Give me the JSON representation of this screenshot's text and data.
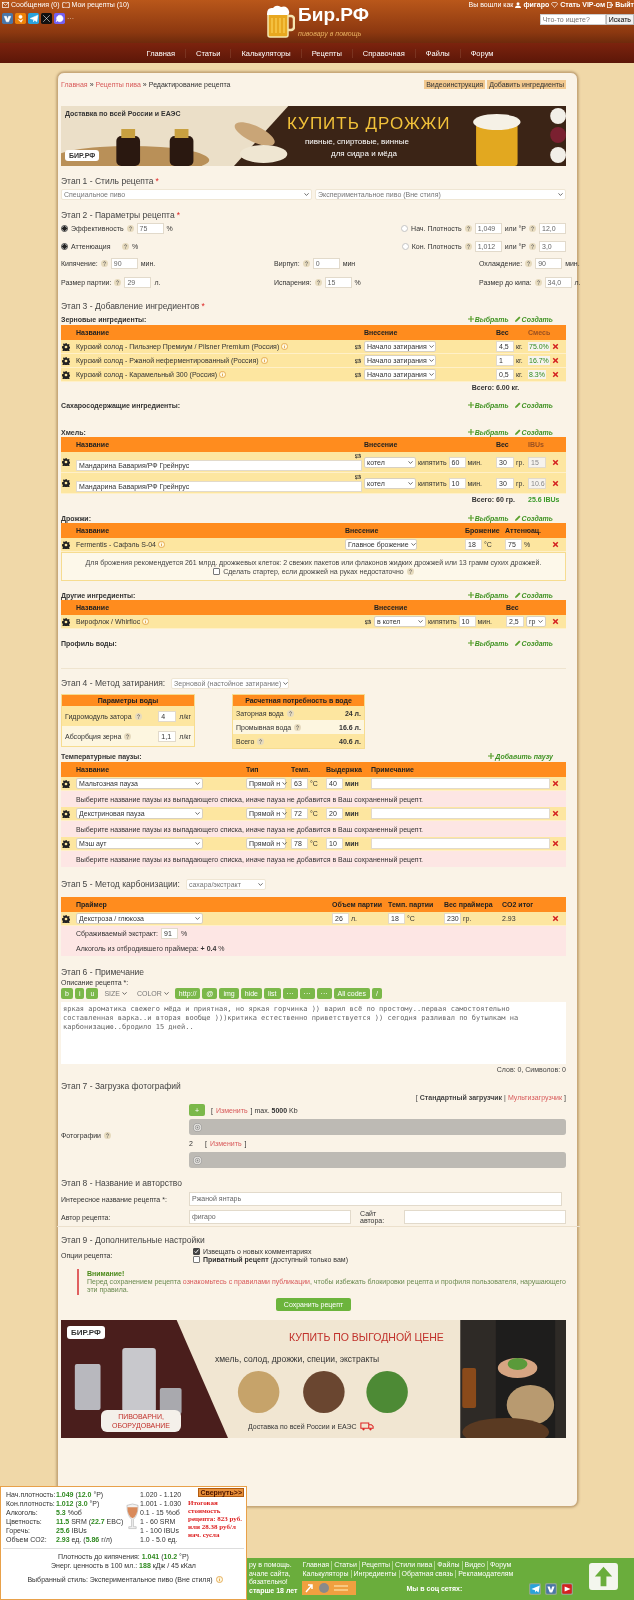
{
  "header": {
    "messages": "Сообщения (0)",
    "recipes": "Мои рецепты (10)",
    "login_prefix": "Вы вошли как",
    "user": "фигаро",
    "vip": "Стать VIP-ом",
    "logout": "Выйт",
    "share_more": "···",
    "logo": "Бир.РФ",
    "tagline": "пивовару в помощь",
    "search_placeholder": "Что-то ищете?",
    "search_button": "Искать"
  },
  "nav": [
    "Главная",
    "Статьи",
    "Калькуляторы",
    "Рецепты",
    "Справочная",
    "Файлы",
    "Форум"
  ],
  "breadcrumbs": {
    "items": [
      {
        "text": "Главная",
        "sep": "»"
      },
      {
        "text": "Рецепты пива",
        "sep": "»"
      }
    ],
    "current": "Редактирование рецепта"
  },
  "actions": [
    "Видеоинструкция",
    "Добавить ингредиенты"
  ],
  "banner_top": {
    "delivery": "Доставка по всей России и ЕАЭС",
    "brand": "БИР.РФ",
    "headline": "КУПИТЬ ДРОЖЖИ",
    "line1": "пивные, спиртовые, винные",
    "line2": "для сидра и мёда"
  },
  "stage1": {
    "title": "Этап 1 - Стиль рецепта",
    "required": "*",
    "selects": [
      "Специальное пиво",
      "Экспериментальное пиво (Вне стиля)"
    ]
  },
  "stage2": {
    "title": "Этап 2 - Параметры рецепта",
    "required": "*",
    "radio_rows": [
      {
        "left": {
          "label": "Эффективность",
          "selected": true,
          "value": "75",
          "unit": "%"
        },
        "right": {
          "label": "Нач. Плотность",
          "selected": false,
          "value": "1,049",
          "alt_label": "или °P",
          "alt_value": "12,0"
        }
      },
      {
        "left": {
          "label": "Аттенюация",
          "selected": true,
          "unit": "%"
        },
        "right": {
          "label": "Кон. Плотность",
          "selected": false,
          "value": "1,012",
          "alt_label": "или °P",
          "alt_value": "3,0"
        }
      }
    ],
    "rows": [
      [
        {
          "label": "Кипячение:",
          "value": "90",
          "unit": "мин."
        },
        {
          "label": "Вирпул:",
          "value": "0",
          "unit": "мин"
        },
        {
          "label": "Охлаждение:",
          "value": "90",
          "unit": "мин."
        }
      ],
      [
        {
          "label": "Размер партии:",
          "value": "29",
          "unit": "л."
        },
        {
          "label": "Испарения:",
          "value": "15",
          "unit": "%"
        },
        {
          "label": "Размер до кипа:",
          "value": "34,0",
          "unit": "л."
        }
      ]
    ]
  },
  "stage3": {
    "title": "Этап 3 - Добавление ингредиентов",
    "required": "*",
    "sections": [
      {
        "kind": "grain",
        "label": "Зерновые ингредиенты:",
        "select_link": "Выбрать",
        "create_link": "Создать",
        "columns": [
          {
            "label": "Название",
            "muted": false
          },
          {
            "label": "Внесение",
            "muted": false
          },
          {
            "label": "Вес",
            "muted": false
          },
          {
            "label": "Смесь",
            "muted": true
          }
        ],
        "rows": [
          {
            "name": "Курский солод - Пильзнер Премиум / Pilsner Premium (Россия)",
            "addition": "Начало затирания",
            "weight": "4,5",
            "unit": "кг.",
            "share": "75.0%"
          },
          {
            "name": "Курский солод - Ржаной неферментированный (Россия)",
            "addition": "Начало затирания",
            "weight": "1",
            "unit": "кг.",
            "share": "16.7%"
          },
          {
            "name": "Курский солод - Карамельный 300 (Россия)",
            "addition": "Начало затирания",
            "weight": "0,5",
            "unit": "кг.",
            "share": "8.3%"
          }
        ],
        "total": {
          "label": "Всего:",
          "weight": "6.00 кг."
        }
      },
      {
        "kind": "sugar",
        "label": "Сахаросодержащие ингредиенты:",
        "select_link": "Выбрать",
        "create_link": "Создать"
      },
      {
        "kind": "hops",
        "label": "Хмель:",
        "select_link": "Выбрать",
        "create_link": "Создать",
        "columns": [
          {
            "label": "Название",
            "muted": false
          },
          {
            "label": "Внесение",
            "muted": false
          },
          {
            "label": "Вес",
            "muted": false
          },
          {
            "label": "IBUs",
            "muted": true
          }
        ],
        "rows": [
          {
            "name": "Мандарина Бавария/РФ Грейнрус",
            "addition": "котел",
            "action": "кипятить",
            "time": "60",
            "time_unit": "мин.",
            "weight": "30",
            "unit": "гр.",
            "ibu": "15"
          },
          {
            "name": "Мандарина Бавария/РФ Грейнрус",
            "addition": "котел",
            "action": "кипятить",
            "time": "10",
            "time_unit": "мин.",
            "weight": "30",
            "unit": "гр.",
            "ibu": "10.6"
          }
        ],
        "total": {
          "label": "Всего:",
          "weight": "60 гр.",
          "ibu": "25.6 IBUs"
        }
      },
      {
        "kind": "yeast",
        "label": "Дрожжи:",
        "select_link": "Выбрать",
        "create_link": "Создать",
        "columns": [
          {
            "label": "Название"
          },
          {
            "label": "Внесение"
          },
          {
            "label": "Брожение"
          },
          {
            "label": "Аттенюац."
          }
        ],
        "rows": [
          {
            "name": "Fermentis - Сафэль S-04",
            "addition": "Главное брожение",
            "temp": "18",
            "temp_unit": "°C",
            "atten": "75",
            "atten_unit": "%"
          }
        ],
        "note": "Для брожения рекомендуется 261 млрд. дрожжевых клеток: 2 свежих пакетов или флаконов жидких дрожжей или 13 грамм сухих дрожжей.",
        "starter": {
          "label": "Сделать стартер, если дрожжей на руках недостаточно",
          "checked": false
        }
      },
      {
        "kind": "other",
        "label": "Другие ингредиенты:",
        "select_link": "Выбрать",
        "create_link": "Создать",
        "columns": [
          {
            "label": "Название"
          },
          {
            "label": "Внесение"
          },
          {
            "label": "Вес"
          }
        ],
        "rows": [
          {
            "name": "Вирофлок / Whirfloc",
            "addition": "в котел",
            "action": "кипятить",
            "time": "10",
            "time_unit": "мин.",
            "weight": "2,5",
            "unit": "гр"
          }
        ]
      },
      {
        "kind": "water",
        "label": "Профиль воды:",
        "select_link": "Выбрать",
        "create_link": "Создать"
      }
    ]
  },
  "stage4": {
    "title": "Этап 4 - Метод затирания:",
    "method": "Зерновой (настойное затирание)",
    "water_params": {
      "title": "Параметры воды",
      "rows": [
        {
          "label": "Гидромодуль затора",
          "value": "4",
          "unit": "л/кг"
        },
        {
          "label": "Абсорбция зерна",
          "value": "1,1",
          "unit": "л/кг"
        }
      ]
    },
    "water_need": {
      "title": "Расчетная потребность в воде",
      "rows": [
        {
          "label": "Заторная вода",
          "value": "24 л."
        },
        {
          "label": "Промывная вода",
          "value": "16.6 л."
        },
        {
          "label": "Всего",
          "value": "40.6 л."
        }
      ]
    },
    "pauses": {
      "label": "Температурные паузы:",
      "add_link": "Добавить паузу",
      "columns": [
        {
          "label": "Название"
        },
        {
          "label": "Тип"
        },
        {
          "label": "Темп."
        },
        {
          "label": "Выдержка"
        },
        {
          "label": "Примечание"
        }
      ],
      "rows": [
        {
          "name": "Мальтозная пауза",
          "type": "Прямой н",
          "temp": "63",
          "temp_unit": "°C",
          "hold": "40",
          "hold_unit": "мин",
          "warning": "Выберите название паузы из выпадающего списка, иначе пауза не добавится в Ваш сохраненный рецепт."
        },
        {
          "name": "Декстриновая пауза",
          "type": "Прямой н",
          "temp": "72",
          "temp_unit": "°C",
          "hold": "20",
          "hold_unit": "мин",
          "warning": "Выберите название паузы из выпадающего списка, иначе пауза не добавится в Ваш сохраненный рецепт."
        },
        {
          "name": "Мэш аут",
          "type": "Прямой н",
          "temp": "78",
          "temp_unit": "°C",
          "hold": "10",
          "hold_unit": "мин",
          "warning": "Выберите название паузы из выпадающего списка, иначе пауза не добавится в Ваш сохраненный рецепт."
        }
      ]
    }
  },
  "stage5": {
    "title": "Этап 5 - Метод карбонизации:",
    "method": "сахара/экстракт",
    "columns": [
      {
        "label": "Праймер"
      },
      {
        "label": "Объем партии"
      },
      {
        "label": "Темп. партии"
      },
      {
        "label": "Вес праймера"
      },
      {
        "label": "CO2 итог"
      }
    ],
    "rows": [
      {
        "primer": "Декстроза / глюкоза",
        "volume": "26",
        "volume_unit": "л.",
        "temp": "18",
        "temp_unit": "°C",
        "weight": "230",
        "weight_unit": "гр.",
        "co2": "2.93"
      }
    ],
    "extract": {
      "label": "Сбраживаемый экстракт:",
      "value": "91",
      "unit": "%"
    },
    "alcohol": "Алкоголь из отбродившего праймера: **+ 0.4** %"
  },
  "stage6": {
    "title": "Этап 6 - Примечание",
    "label": "Описание рецепта *:",
    "toolbar": [
      {
        "kind": "button",
        "label": "b"
      },
      {
        "kind": "button",
        "label": "i"
      },
      {
        "kind": "button",
        "label": "u"
      },
      {
        "kind": "select",
        "label": "SIZE"
      },
      {
        "kind": "select",
        "label": "COLOR"
      },
      {
        "kind": "button",
        "label": "http://"
      },
      {
        "kind": "button",
        "label": "@"
      },
      {
        "kind": "button",
        "label": "img"
      },
      {
        "kind": "button",
        "label": "hide"
      },
      {
        "kind": "button",
        "label": "list"
      },
      {
        "kind": "button",
        "label": "···"
      },
      {
        "kind": "button",
        "label": "···"
      },
      {
        "kind": "button",
        "label": "···"
      },
      {
        "kind": "button",
        "label": "All codes"
      },
      {
        "kind": "button",
        "label": "/"
      }
    ],
    "text": "яркая ароматика свежего мёда и приятная, но яркая горчинка )) варил всё по простому..первая самостоятельно составленная варка..и вторая вообще )))критика естественно приветствуется )) сегодня разливал по бутылкам на карбонизацию..бродило 15 дней..",
    "counter": "Слов: 0, Символов: 0"
  },
  "stage7": {
    "title": "Этап 7 - Загрузка фотографий",
    "uploader": {
      "open": "[",
      "current": "Стандартный загрузчик",
      "divider": "|",
      "other": "Мультизагрузчик",
      "close": "]"
    },
    "label": "Фотографии",
    "slots": [
      {
        "kind": "button",
        "label": "+",
        "before": "[",
        "link": "Изменить",
        "after": "] max. **5000** Kb",
        "level": 1
      },
      {
        "kind": "number",
        "label": "2",
        "before": "[",
        "link": "Изменить",
        "after": "]",
        "level": 1
      }
    ]
  },
  "stage8": {
    "title": "Этап 8 - Название и авторство",
    "name_label": "Интересное название рецепта *:",
    "name_value": "Ржаной янтарь",
    "author_label": "Автор рецепта:",
    "author_value": "фигаро",
    "site_label": "Сайт автора:"
  },
  "stage9": {
    "title": "Этап 9 - Дополнительные настройки",
    "label": "Опции рецепта:",
    "options": [
      {
        "label": "Извещать о новых комментариях",
        "checked": true
      },
      {
        "label": "**Приватный рецепт** (доступный только вам)",
        "checked": false
      }
    ],
    "warning": {
      "title": "Внимание!",
      "before": "Перед сохранением рецепта ",
      "link": "ознакомьтесь с правилами публикации",
      "after": ", чтобы избежать блокировки рецепта и профиля пользователя, нарушающего эти правила."
    },
    "save": "Сохранить рецепт"
  },
  "banner_bottom": {
    "brand": "БИР.РФ",
    "headline": "КУПИТЬ ПО ВЫГОДНОЙ ЦЕНЕ",
    "subline": "хмель, солод, дрожжи, специи, экстракты",
    "delivery": "Доставка по всей России и ЕАЭС",
    "badge": "ПИВОВАРНИ, ОБОРУДОВАНИЕ"
  },
  "calc": {
    "rows": [
      {
        "label": "Нач.плотность:",
        "value": "**1.049** (**12.0** °P)",
        "range": "1.020 - 1.120"
      },
      {
        "label": "Кон.плотность:",
        "value": "**1.012** (**3.0** °P)",
        "range": "1.001 - 1.030"
      },
      {
        "label": "Алкоголь:",
        "value": "**5.3** %об",
        "range": "0.1 - 15 %об"
      },
      {
        "label": "Цветность:",
        "value": "**11.5** SRM (**22.7** EBC)",
        "range": "1 - 60 SRM"
      },
      {
        "label": "Горечь:",
        "value": "**25.6** IBUs",
        "range": "1 - 100 IBUs"
      },
      {
        "label": "Объем CO2:",
        "value": "**2.93** ед. (**5.86** г/л)",
        "range": "1.0 - 5.0 ед."
      }
    ],
    "collapse": "Свернуть>>",
    "cost": "Итоговая стоимость рецепта: 823 руб. или 28.38 руб/л нач. сусла",
    "boil_gravity": "Плотность до кипячения: **1.041** (**10.2** °P)",
    "energy": "Энерг. ценность в 100 мл.: **188** кДж / 45 кКал",
    "style": "Выбранный стиль: Экспериментальное пиво (Вне стиля)"
  },
  "footer": {
    "about": [
      "ру в помощь.",
      "ачале сайта,",
      "бязательно!",
      "старше 18 лет"
    ],
    "links": [
      [
        "Главная",
        "Статьи",
        "Рецепты",
        "Стили пива",
        "Файлы",
        "Видео",
        "Форум"
      ],
      [
        "Калькуляторы",
        "Ингредиенты",
        "Обратная связь",
        "Рекламодателям"
      ]
    ],
    "social_label": "Мы в соц сетях:"
  }
}
